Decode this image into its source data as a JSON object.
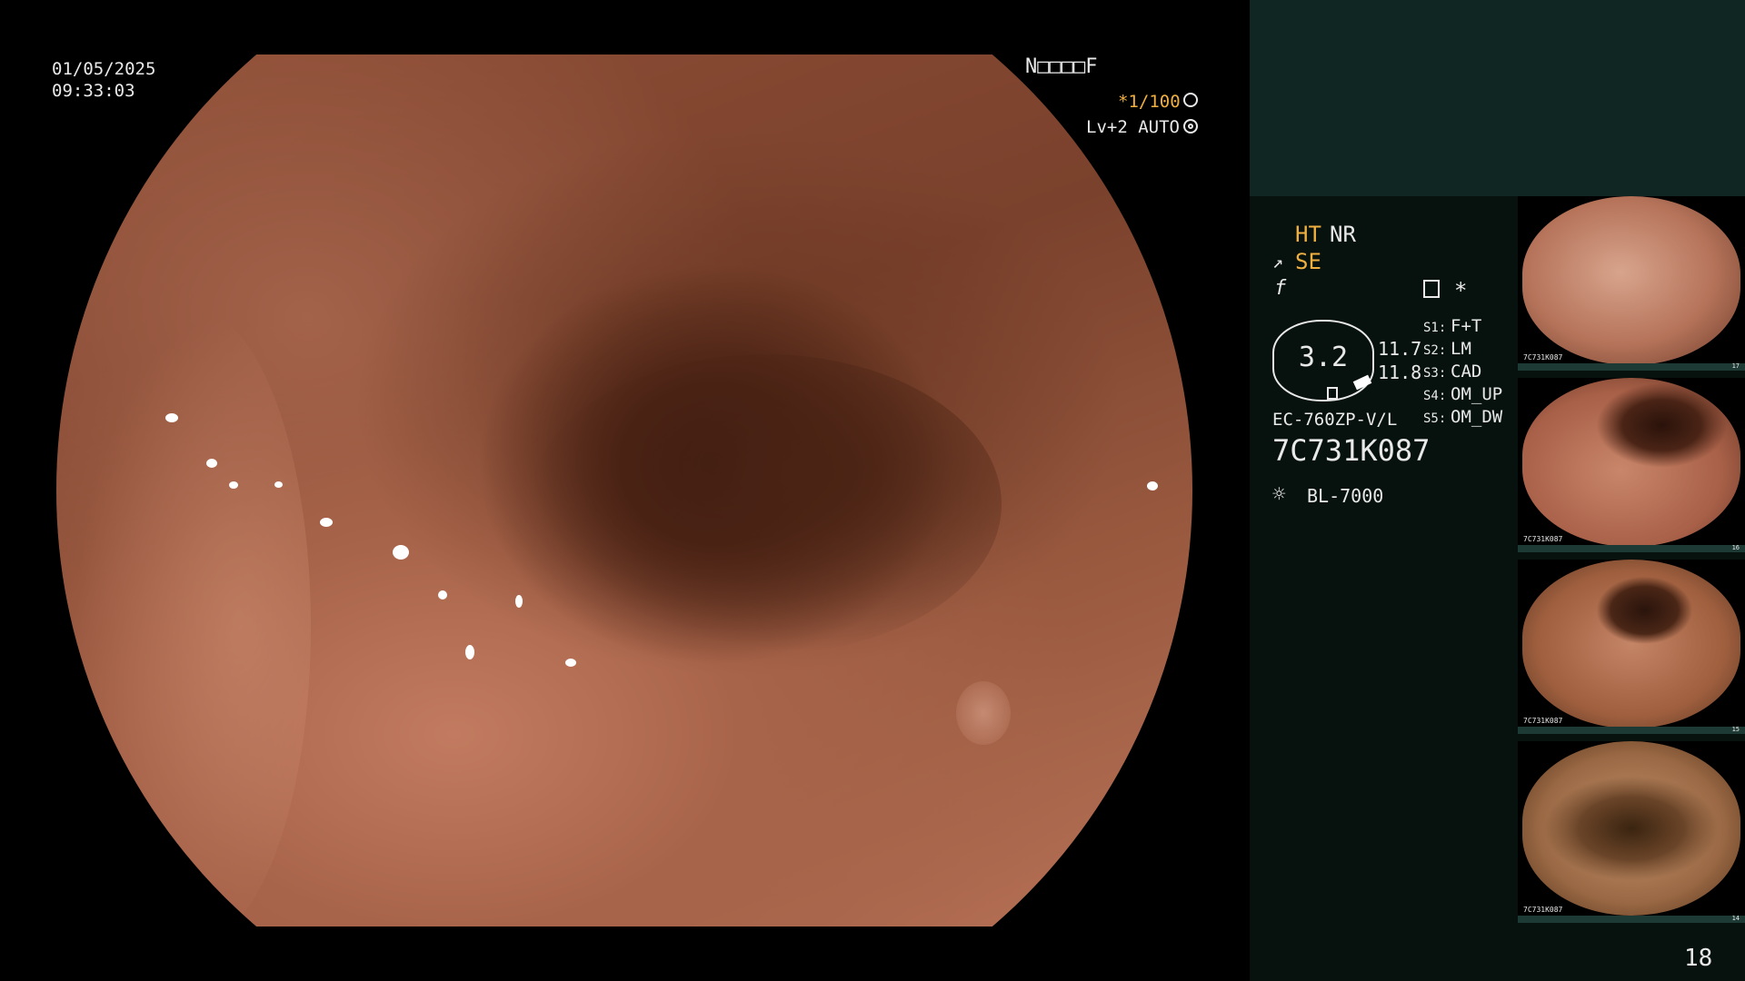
{
  "overlay": {
    "date": "01/05/2025",
    "time": "09:33:03",
    "patient_id": "N□□□□F",
    "shutter": "*1/100",
    "level": "Lv+2 AUTO"
  },
  "settings": {
    "ht": "HT",
    "nr": "NR",
    "se": "SE",
    "zoom": "3.2",
    "value_a": "11.7",
    "value_b": "11.8",
    "scope_model": "EC-760ZP-V/L",
    "serial": "7C731K087",
    "light_source": "BL-7000",
    "asterisk": "*",
    "switches": [
      {
        "key": "S1:",
        "value": "F+T"
      },
      {
        "key": "S2:",
        "value": "LM"
      },
      {
        "key": "S3:",
        "value": "CAD"
      },
      {
        "key": "S4:",
        "value": "OM_UP"
      },
      {
        "key": "S5:",
        "value": "OM_DW"
      }
    ]
  },
  "thumbnails": [
    {
      "index": "17",
      "serial": "7C731K087"
    },
    {
      "index": "16",
      "serial": "7C731K087"
    },
    {
      "index": "15",
      "serial": "7C731K087"
    },
    {
      "index": "14",
      "serial": "7C731K087"
    }
  ],
  "image_count": "18",
  "icons": [
    "aperture-icon",
    "iris-icon",
    "enhance-icon",
    "fx-icon",
    "menu-icon",
    "light-icon"
  ],
  "colors": {
    "accent": "#f0b040",
    "panel": "#07120f",
    "panel_top": "#0f2622"
  }
}
